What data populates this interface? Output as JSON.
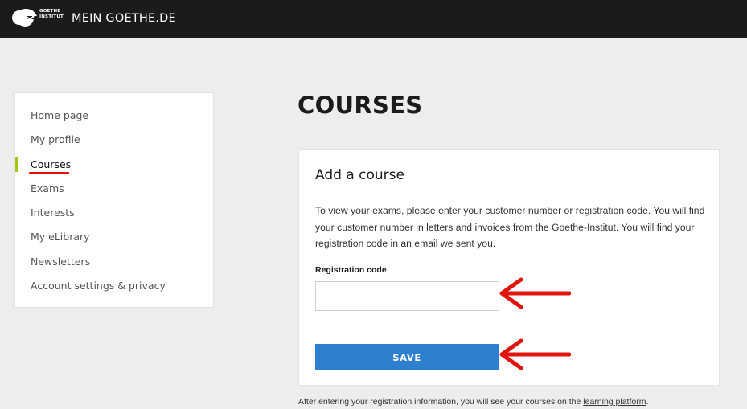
{
  "header": {
    "logo_line1": "GOETHE",
    "logo_line2": "INSTITUT",
    "site_title": "MEIN GOETHE.DE"
  },
  "sidebar": {
    "items": [
      {
        "label": "Home page"
      },
      {
        "label": "My profile"
      },
      {
        "label": "Courses",
        "active": true
      },
      {
        "label": "Exams"
      },
      {
        "label": "Interests"
      },
      {
        "label": "My eLibrary"
      },
      {
        "label": "Newsletters"
      },
      {
        "label": "Account settings & privacy"
      }
    ]
  },
  "main": {
    "page_title": "COURSES",
    "card": {
      "title": "Add a course",
      "description": "To view your exams, please enter your customer number or registration code. You will find your customer number in letters and invoices from the Goethe-Institut. You will find your registration code in an email we sent you.",
      "field_label": "Registration code",
      "field_value": "",
      "save_label": "SAVE"
    },
    "footer_text": "After entering your registration information, you will see your courses on the ",
    "footer_link": "learning platform",
    "footer_end": "."
  },
  "colors": {
    "topbar": "#1b1b1b",
    "accent_green": "#a0c814",
    "button_blue": "#2f7fcf",
    "annotation_red": "#e0140c"
  },
  "icons": {
    "logo": "goethe-logo-icon",
    "annotation": "arrow-left-icon"
  }
}
